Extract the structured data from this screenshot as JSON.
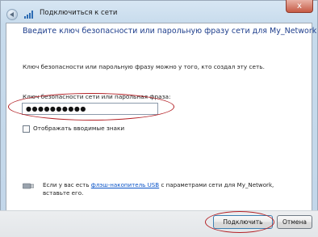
{
  "window": {
    "title": "Подключиться к сети",
    "close_glyph": "x"
  },
  "dialog": {
    "heading": "Введите ключ безопасности или парольную фразу сети для My_Network",
    "description": "Ключ безопасности или парольную фразу можно у того, кто создал эту сеть.",
    "key_label": "Ключ безопасности сети или парольная фраза:",
    "key_value": "●●●●●●●●●●",
    "show_chars_label": "Отображать вводимые знаки",
    "show_chars_checked": false,
    "usb": {
      "line1_prefix": "Если у вас есть ",
      "line1_link": "флэш-накопитель USB",
      "line1_suffix": " с параметрами сети для My_Network,",
      "line2": "вставьте его."
    }
  },
  "buttons": {
    "connect": "Подключить",
    "cancel": "Отмена"
  },
  "colors": {
    "heading": "#1e3e8c",
    "link": "#0a54c8",
    "annotation": "#b32025"
  }
}
